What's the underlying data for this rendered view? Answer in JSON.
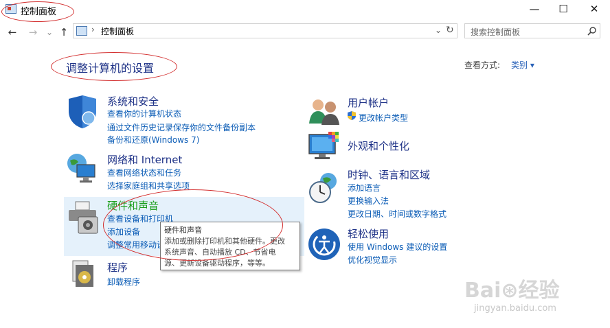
{
  "window": {
    "title": "控制面板",
    "min_glyph": "—",
    "max_glyph": "☐",
    "close_glyph": "✕"
  },
  "nav": {
    "back": "←",
    "forward": "→",
    "history": "⌄",
    "up": "↑"
  },
  "address": {
    "separator": "›",
    "crumb": "控制面板",
    "dropdown": "⌄",
    "refresh": "↻"
  },
  "search": {
    "placeholder": "搜索控制面板"
  },
  "heading": {
    "title": "调整计算机的设置",
    "view_by_label": "查看方式:",
    "view_by_value": "类别 ▾"
  },
  "categories": {
    "system": {
      "title": "系统和安全",
      "links": [
        "查看你的计算机状态",
        "通过文件历史记录保存你的文件备份副本",
        "备份和还原(Windows 7)"
      ]
    },
    "network": {
      "title": "网络和 Internet",
      "links": [
        "查看网络状态和任务",
        "选择家庭组和共享选项"
      ]
    },
    "hardware": {
      "title": "硬件和声音",
      "links": [
        "查看设备和打印机",
        "添加设备",
        "调整常用移动设"
      ]
    },
    "programs": {
      "title": "程序",
      "links": [
        "卸载程序"
      ]
    },
    "users": {
      "title": "用户帐户",
      "links": [
        "更改帐户类型"
      ]
    },
    "appearance": {
      "title": "外观和个性化",
      "links": []
    },
    "clock": {
      "title": "时钟、语言和区域",
      "links": [
        "添加语言",
        "更换输入法",
        "更改日期、时间或数字格式"
      ]
    },
    "ease": {
      "title": "轻松使用",
      "links": [
        "使用 Windows 建议的设置",
        "优化视觉显示"
      ]
    }
  },
  "tooltip": {
    "title": "硬件和声音",
    "line1": "添加或删除打印机和其他硬件。更改",
    "line2": "系统声音、自动播放 CD、节省电",
    "line3": "源、更新设备驱动程序，等等。"
  },
  "watermark": {
    "logo": "Bai⊛经验",
    "url": "jingyan.baidu.com"
  }
}
